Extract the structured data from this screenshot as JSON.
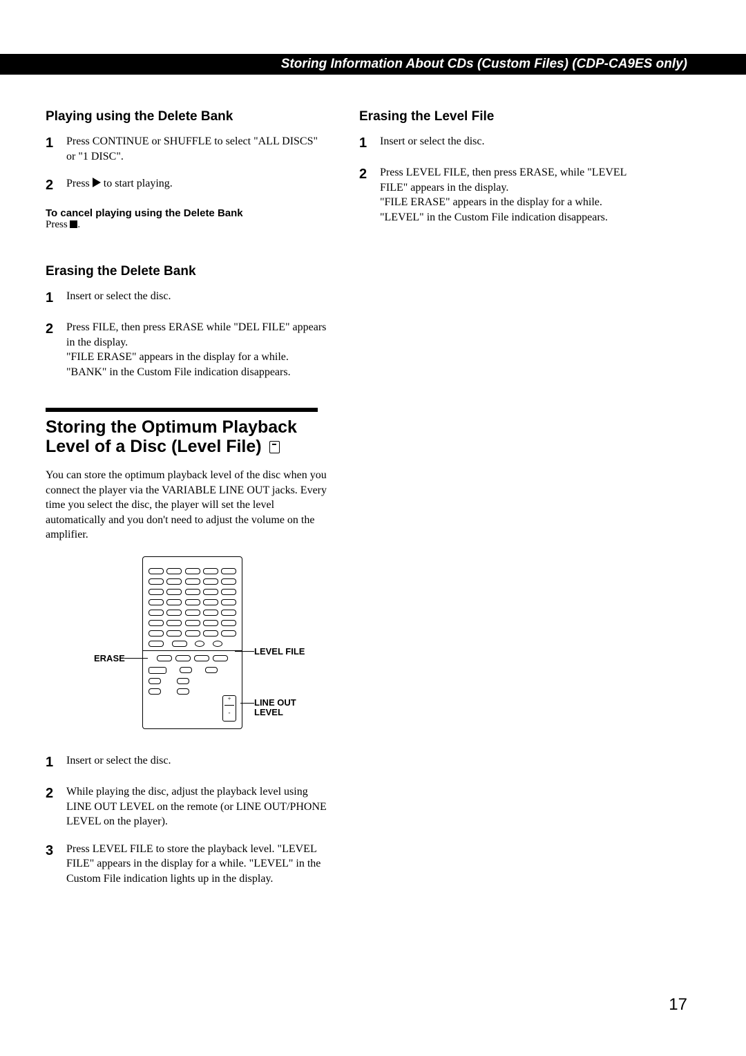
{
  "header": "Storing Information About CDs (Custom Files) (CDP-CA9ES only)",
  "left": {
    "playing": {
      "heading": "Playing using the Delete Bank",
      "steps": [
        "Press CONTINUE or SHUFFLE to select \"ALL DISCS\" or \"1 DISC\".",
        "Press ▶ to start playing."
      ]
    },
    "cancel": {
      "title": "To cancel playing using the Delete Bank",
      "body": "Press ■."
    },
    "erasingDelete": {
      "heading": "Erasing the Delete Bank",
      "steps": [
        "Insert or select the disc.",
        "Press FILE, then press ERASE while \"DEL FILE\" appears in the display.\n\"FILE ERASE\" appears in the display for a while.\n\"BANK\" in the Custom File indication disappears."
      ]
    },
    "levelFile": {
      "title": "Storing the Optimum Playback Level of a Disc (Level File)",
      "intro": "You can store the optimum playback level of the disc when you connect the player via the VARIABLE LINE OUT jacks. Every time you select the disc, the player will set the level automatically and you don't need to adjust the volume on the amplifier.",
      "labels": {
        "erase": "ERASE",
        "levelfile": "LEVEL FILE",
        "lineout": "LINE OUT LEVEL"
      },
      "steps": [
        "Insert or select the disc.",
        "While playing the disc, adjust the playback level using LINE OUT LEVEL on the remote (or LINE OUT/PHONE LEVEL on the player).",
        "Press LEVEL FILE to store the playback level. \"LEVEL FILE\" appears in the display for a while. \"LEVEL\" in the Custom File indication lights up in the display."
      ]
    }
  },
  "right": {
    "erasingLevel": {
      "heading": "Erasing the Level File",
      "steps": [
        "Insert or select the disc.",
        "Press LEVEL FILE, then press ERASE, while \"LEVEL FILE\" appears in the display.\n\"FILE ERASE\" appears in the display for a while.\n\"LEVEL\" in the Custom File indication disappears."
      ]
    }
  },
  "pageNumber": "17"
}
